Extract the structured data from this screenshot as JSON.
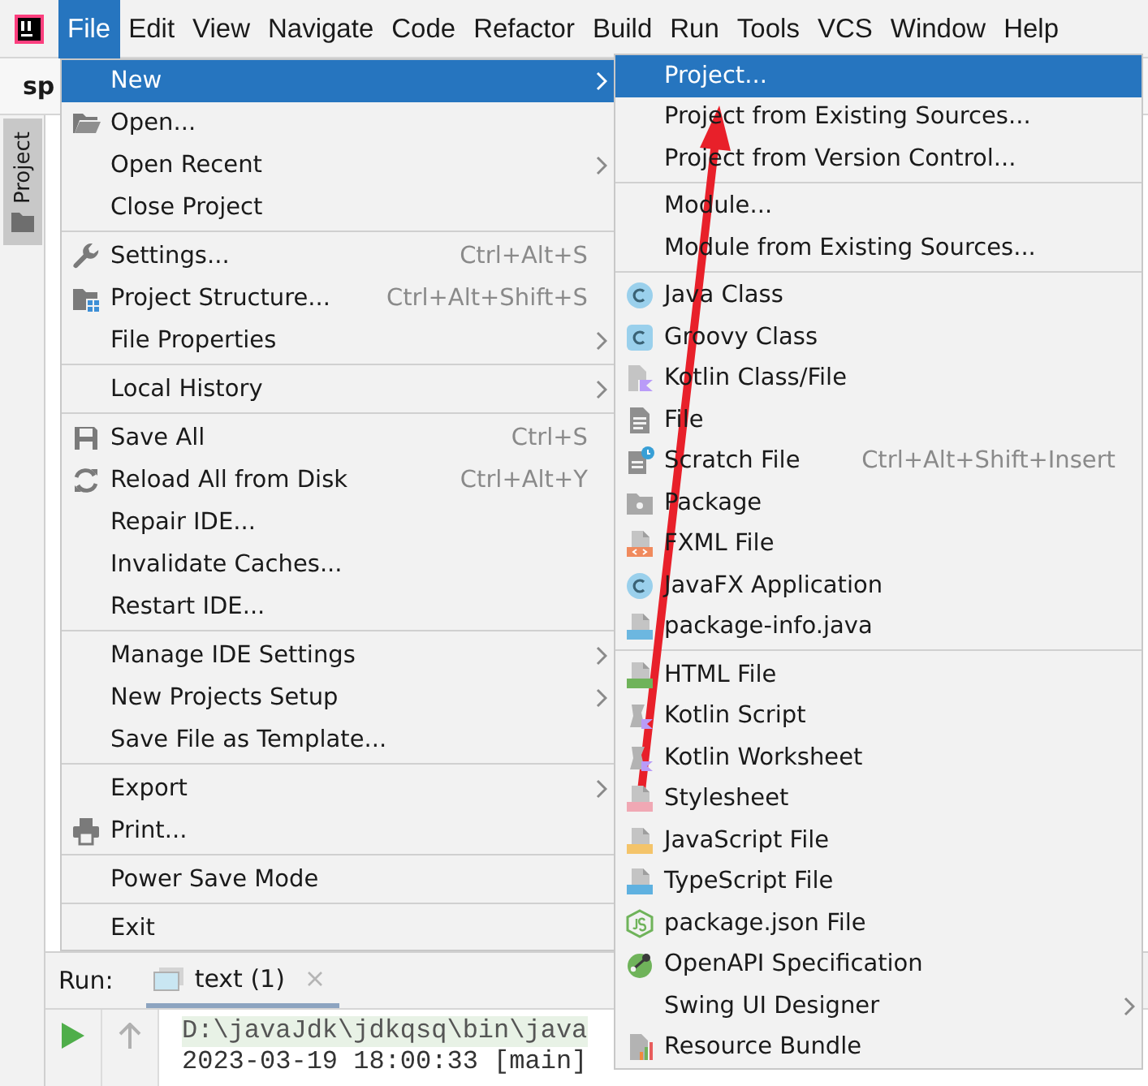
{
  "menu_bar": {
    "items": [
      {
        "label": "File",
        "selected": true
      },
      {
        "label": "Edit",
        "selected": false
      },
      {
        "label": "View",
        "selected": false
      },
      {
        "label": "Navigate",
        "selected": false
      },
      {
        "label": "Code",
        "selected": false
      },
      {
        "label": "Refactor",
        "selected": false
      },
      {
        "label": "Build",
        "selected": false
      },
      {
        "label": "Run",
        "selected": false
      },
      {
        "label": "Tools",
        "selected": false
      },
      {
        "label": "VCS",
        "selected": false
      },
      {
        "label": "Window",
        "selected": false
      },
      {
        "label": "Help",
        "selected": false
      }
    ]
  },
  "toolbar": {
    "project_name": "sp"
  },
  "tool_window_stripe": {
    "tabs": [
      {
        "label": "Project",
        "selected": true
      }
    ]
  },
  "file_menu": {
    "groups": [
      {
        "items": [
          {
            "label": "New",
            "kind": "plain",
            "submenu": true,
            "selected": true
          },
          {
            "label": "Open...",
            "kind": "folder",
            "submenu": false,
            "selected": false
          },
          {
            "label": "Open Recent",
            "kind": "plain",
            "submenu": true,
            "selected": false
          },
          {
            "label": "Close Project",
            "kind": "plain",
            "submenu": false,
            "selected": false
          }
        ]
      },
      {
        "items": [
          {
            "label": "Settings...",
            "kind": "wrench",
            "shortcut": "Ctrl+Alt+S",
            "submenu": false,
            "selected": false
          },
          {
            "label": "Project Structure...",
            "kind": "structure",
            "shortcut": "Ctrl+Alt+Shift+S",
            "submenu": false,
            "selected": false
          },
          {
            "label": "File Properties",
            "kind": "plain",
            "submenu": true,
            "selected": false
          }
        ]
      },
      {
        "items": [
          {
            "label": "Local History",
            "kind": "plain",
            "submenu": true,
            "selected": false
          }
        ]
      },
      {
        "items": [
          {
            "label": "Save All",
            "kind": "floppy",
            "shortcut": "Ctrl+S",
            "submenu": false,
            "selected": false
          },
          {
            "label": "Reload All from Disk",
            "kind": "reload",
            "shortcut": "Ctrl+Alt+Y",
            "submenu": false,
            "selected": false
          },
          {
            "label": "Repair IDE...",
            "kind": "plain",
            "submenu": false,
            "selected": false
          },
          {
            "label": "Invalidate Caches...",
            "kind": "plain",
            "submenu": false,
            "selected": false
          },
          {
            "label": "Restart IDE...",
            "kind": "plain",
            "submenu": false,
            "selected": false
          }
        ]
      },
      {
        "items": [
          {
            "label": "Manage IDE Settings",
            "kind": "plain",
            "submenu": true,
            "selected": false
          },
          {
            "label": "New Projects Setup",
            "kind": "plain",
            "submenu": true,
            "selected": false
          },
          {
            "label": "Save File as Template...",
            "kind": "plain",
            "submenu": false,
            "selected": false
          }
        ]
      },
      {
        "items": [
          {
            "label": "Export",
            "kind": "plain",
            "submenu": true,
            "selected": false
          },
          {
            "label": "Print...",
            "kind": "printer",
            "submenu": false,
            "selected": false
          }
        ]
      },
      {
        "items": [
          {
            "label": "Power Save Mode",
            "kind": "plain",
            "submenu": false,
            "selected": false
          }
        ]
      },
      {
        "items": [
          {
            "label": "Exit",
            "kind": "plain",
            "submenu": false,
            "selected": false
          }
        ]
      }
    ]
  },
  "new_submenu": {
    "groups": [
      {
        "items": [
          {
            "label": "Project...",
            "kind": "plain",
            "submenu": false,
            "selected": true
          },
          {
            "label": "Project from Existing Sources...",
            "kind": "plain",
            "submenu": false,
            "selected": false
          },
          {
            "label": "Project from Version Control...",
            "kind": "plain",
            "submenu": false,
            "selected": false
          }
        ]
      },
      {
        "items": [
          {
            "label": "Module...",
            "kind": "plain",
            "submenu": false,
            "selected": false
          },
          {
            "label": "Module from Existing Sources...",
            "kind": "plain",
            "submenu": false,
            "selected": false
          }
        ]
      },
      {
        "items": [
          {
            "label": "Java Class",
            "kind": "class",
            "submenu": false,
            "selected": false
          },
          {
            "label": "Groovy Class",
            "kind": "groovy",
            "submenu": false,
            "selected": false
          },
          {
            "label": "Kotlin Class/File",
            "kind": "kotlin",
            "submenu": false,
            "selected": false
          },
          {
            "label": "File",
            "kind": "text",
            "submenu": false,
            "selected": false
          },
          {
            "label": "Scratch File",
            "kind": "scratch",
            "shortcut": "Ctrl+Alt+Shift+Insert",
            "submenu": false,
            "selected": false
          },
          {
            "label": "Package",
            "kind": "package",
            "submenu": false,
            "selected": false
          },
          {
            "label": "FXML File",
            "kind": "fxml",
            "submenu": false,
            "selected": false
          },
          {
            "label": "JavaFX Application",
            "kind": "class",
            "submenu": false,
            "selected": false
          },
          {
            "label": "package-info.java",
            "kind": "java",
            "submenu": false,
            "selected": false
          }
        ]
      },
      {
        "items": [
          {
            "label": "HTML File",
            "kind": "html",
            "submenu": false,
            "selected": false
          },
          {
            "label": "Kotlin Script",
            "kind": "script",
            "submenu": false,
            "selected": false
          },
          {
            "label": "Kotlin Worksheet",
            "kind": "script",
            "submenu": false,
            "selected": false
          },
          {
            "label": "Stylesheet",
            "kind": "css",
            "submenu": false,
            "selected": false
          },
          {
            "label": "JavaScript File",
            "kind": "js",
            "submenu": false,
            "selected": false
          },
          {
            "label": "TypeScript File",
            "kind": "ts",
            "submenu": false,
            "selected": false
          },
          {
            "label": "package.json File",
            "kind": "npm",
            "submenu": false,
            "selected": false
          },
          {
            "label": "OpenAPI Specification",
            "kind": "openapi",
            "submenu": false,
            "selected": false
          },
          {
            "label": "Swing UI Designer",
            "kind": "plain",
            "submenu": true,
            "selected": false
          },
          {
            "label": "Resource Bundle",
            "kind": "bundle",
            "submenu": false,
            "selected": false
          }
        ]
      }
    ]
  },
  "run_panel": {
    "title": "Run:",
    "tabs": [
      {
        "label": "text (1)",
        "selected": true
      }
    ],
    "console_lines": [
      {
        "text": "D:\\javaJdk\\jdkqsq\\bin\\java",
        "kind": "command"
      },
      {
        "text": "2023-03-19 18:00:33 [main]",
        "kind": "output"
      }
    ]
  }
}
